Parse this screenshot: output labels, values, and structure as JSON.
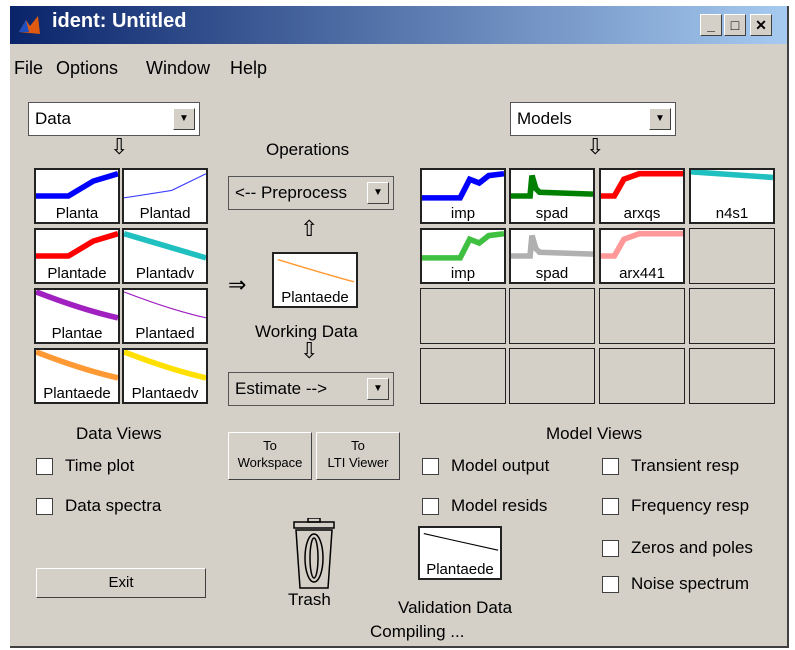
{
  "window": {
    "title": "ident: Untitled"
  },
  "menu": {
    "file": "File",
    "options": "Options",
    "window": "Window",
    "help": "Help"
  },
  "data_select": {
    "value": "Data"
  },
  "models_select": {
    "value": "Models"
  },
  "operations_label": "Operations",
  "preprocess_select": {
    "value": "<-- Preprocess"
  },
  "estimate_select": {
    "value": "Estimate -->"
  },
  "working_data": {
    "name": "Plantaede",
    "label": "Working Data"
  },
  "data_slots": [
    {
      "name": "Planta",
      "color": "#0000ff"
    },
    {
      "name": "Plantad",
      "color": "#4040ff"
    },
    {
      "name": "Plantade",
      "color": "#ff0000"
    },
    {
      "name": "Plantadv",
      "color": "#20c0c0"
    },
    {
      "name": "Plantae",
      "color": "#a020c0"
    },
    {
      "name": "Plantaed",
      "color": "#a020c0"
    },
    {
      "name": "Plantaede",
      "color": "#ff9933"
    },
    {
      "name": "Plantaedv",
      "color": "#ffe000"
    }
  ],
  "model_slots": [
    {
      "name": "imp",
      "color": "#0000ff"
    },
    {
      "name": "spad",
      "color": "#008000"
    },
    {
      "name": "arxqs",
      "color": "#ff0000"
    },
    {
      "name": "n4s1",
      "color": "#20c0c0"
    },
    {
      "name": "imp",
      "color": "#40c040"
    },
    {
      "name": "spad",
      "color": "#b0b0b0"
    },
    {
      "name": "arx441",
      "color": "#ff9999"
    }
  ],
  "data_views": {
    "title": "Data Views",
    "time_plot": "Time plot",
    "data_spectra": "Data spectra"
  },
  "buttons": {
    "to_workspace_line1": "To",
    "to_workspace_line2": "Workspace",
    "to_lti_line1": "To",
    "to_lti_line2": "LTI Viewer",
    "exit": "Exit"
  },
  "model_views": {
    "title": "Model Views",
    "model_output": "Model output",
    "model_resids": "Model resids",
    "transient_resp": "Transient resp",
    "frequency_resp": "Frequency resp",
    "zeros_poles": "Zeros and poles",
    "noise_spectrum": "Noise spectrum"
  },
  "trash": {
    "label": "Trash"
  },
  "validation_data": {
    "name": "Plantaede",
    "label": "Validation Data"
  },
  "status": {
    "text": "Compiling ..."
  }
}
